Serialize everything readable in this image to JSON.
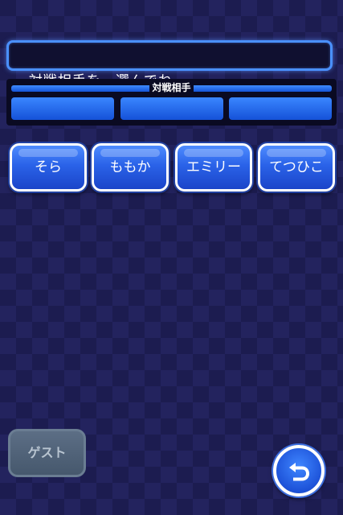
{
  "message": {
    "text": "対戦相手を　選んでね。"
  },
  "opponent_panel": {
    "title": "対戦相手"
  },
  "characters": [
    {
      "label": "そら"
    },
    {
      "label": "ももか"
    },
    {
      "label": "エミリー"
    },
    {
      "label": "てつひこ"
    }
  ],
  "guest_button": {
    "label": "ゲスト",
    "state": "disabled"
  },
  "back_button": {
    "icon": "back-arrow-icon"
  },
  "colors": {
    "background": "#1c1c50",
    "accent_blue": "#2a62e8",
    "button_border": "#ffffff",
    "disabled_gray": "#5c6e85"
  }
}
